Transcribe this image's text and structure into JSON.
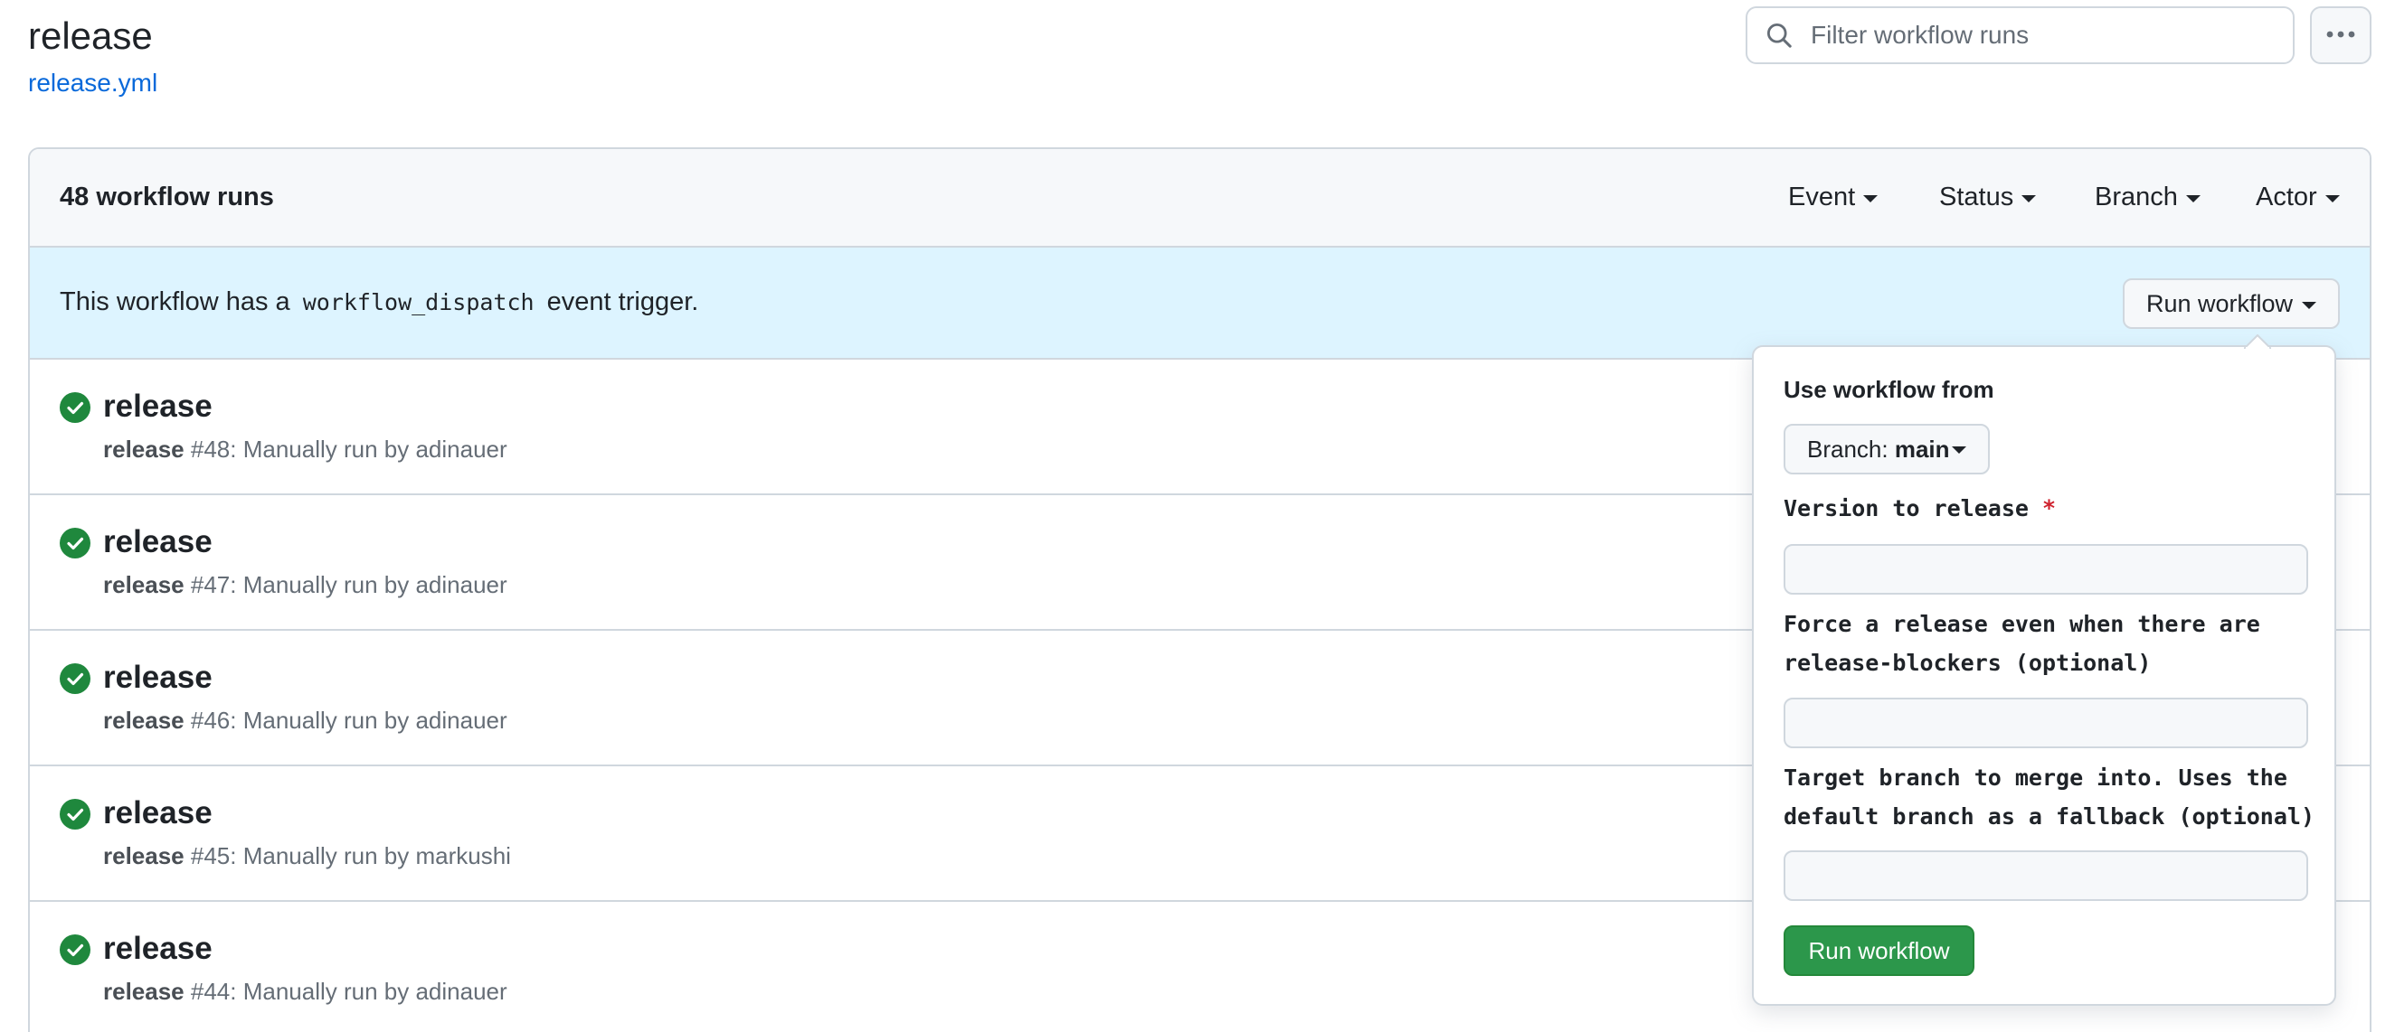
{
  "header": {
    "title": "release",
    "workflow_file": "release.yml",
    "filter_placeholder": "Filter workflow runs",
    "more_icon": "kebab-horizontal-icon"
  },
  "runs_box": {
    "count_label": "48 workflow runs",
    "filters": {
      "event": "Event",
      "status": "Status",
      "branch": "Branch",
      "actor": "Actor"
    },
    "banner": {
      "prefix": "This workflow has a",
      "code": "workflow_dispatch",
      "suffix": "event trigger.",
      "run_button": "Run workflow"
    }
  },
  "runs": [
    {
      "title": "release",
      "workflow": "release",
      "number": " #48: Manually run by adinauer",
      "status": "success"
    },
    {
      "title": "release",
      "workflow": "release",
      "number": " #47: Manually run by adinauer",
      "status": "success"
    },
    {
      "title": "release",
      "workflow": "release",
      "number": " #46: Manually run by adinauer",
      "status": "success"
    },
    {
      "title": "release",
      "workflow": "release",
      "number": " #45: Manually run by markushi",
      "status": "success"
    },
    {
      "title": "release",
      "workflow": "release",
      "number": " #44: Manually run by adinauer",
      "status": "success"
    }
  ],
  "dispatch_form": {
    "use_from_label": "Use workflow from",
    "branch_prefix": "Branch: ",
    "branch_value": "main",
    "version_label": "Version to release",
    "required_mark": "*",
    "force_label": "Force a release even when there are release-blockers (optional)",
    "target_label": "Target branch to merge into. Uses the default branch as a fallback (optional)",
    "version_value": "",
    "force_value": "",
    "target_value": "",
    "submit_label": "Run workflow"
  },
  "colors": {
    "success": "#1f883d",
    "link": "#0969da",
    "banner": "#ddf4ff",
    "primary_button": "#2c974b"
  }
}
